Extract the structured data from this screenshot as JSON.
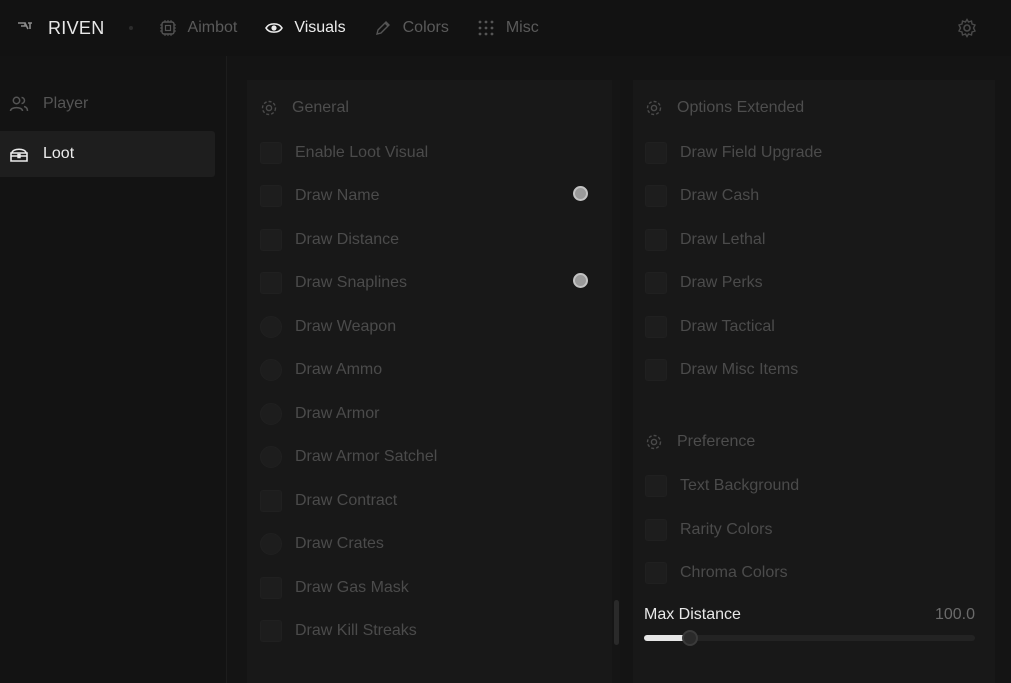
{
  "brand": {
    "name": "RIVEN",
    "logo_icon": "riven-logo-icon"
  },
  "tabs": [
    {
      "label": "Aimbot",
      "icon": "chip-icon",
      "active": false
    },
    {
      "label": "Visuals",
      "icon": "eye-icon",
      "active": true
    },
    {
      "label": "Colors",
      "icon": "pencil-icon",
      "active": false
    },
    {
      "label": "Misc",
      "icon": "grid-dots-icon",
      "active": false
    }
  ],
  "sidebar": {
    "items": [
      {
        "label": "Player",
        "icon": "users-icon",
        "active": false
      },
      {
        "label": "Loot",
        "icon": "loot-chest-icon",
        "active": true
      }
    ]
  },
  "general": {
    "title": "General",
    "options": [
      {
        "label": "Enable Loot Visual",
        "checked": false
      },
      {
        "label": "Draw Name",
        "checked": false,
        "toggle": true
      },
      {
        "label": "Draw Distance",
        "checked": false
      },
      {
        "label": "Draw Snaplines",
        "checked": false,
        "toggle": true
      },
      {
        "label": "Draw Weapon",
        "checked": false
      },
      {
        "label": "Draw Ammo",
        "checked": false
      },
      {
        "label": "Draw Armor",
        "checked": false
      },
      {
        "label": "Draw Armor Satchel",
        "checked": false
      },
      {
        "label": "Draw Contract",
        "checked": false
      },
      {
        "label": "Draw Crates",
        "checked": false
      },
      {
        "label": "Draw Gas Mask",
        "checked": false
      },
      {
        "label": "Draw Kill Streaks",
        "checked": false
      }
    ]
  },
  "options_extended": {
    "title": "Options Extended",
    "options": [
      {
        "label": "Draw Field Upgrade",
        "checked": false
      },
      {
        "label": "Draw Cash",
        "checked": false
      },
      {
        "label": "Draw Lethal",
        "checked": false
      },
      {
        "label": "Draw Perks",
        "checked": false
      },
      {
        "label": "Draw Tactical",
        "checked": false
      },
      {
        "label": "Draw Misc Items",
        "checked": false
      }
    ]
  },
  "preference": {
    "title": "Preference",
    "options": [
      {
        "label": "Text Background",
        "checked": false
      },
      {
        "label": "Rarity Colors",
        "checked": false
      },
      {
        "label": "Chroma Colors",
        "checked": false
      }
    ]
  },
  "max_distance": {
    "label": "Max Distance",
    "value_text": "100.0",
    "fraction": 0.14
  },
  "colors": {
    "background": "#141414",
    "active_text": "#ececec",
    "muted_text": "#4b4b4b",
    "accent": "#e6e6e6"
  }
}
